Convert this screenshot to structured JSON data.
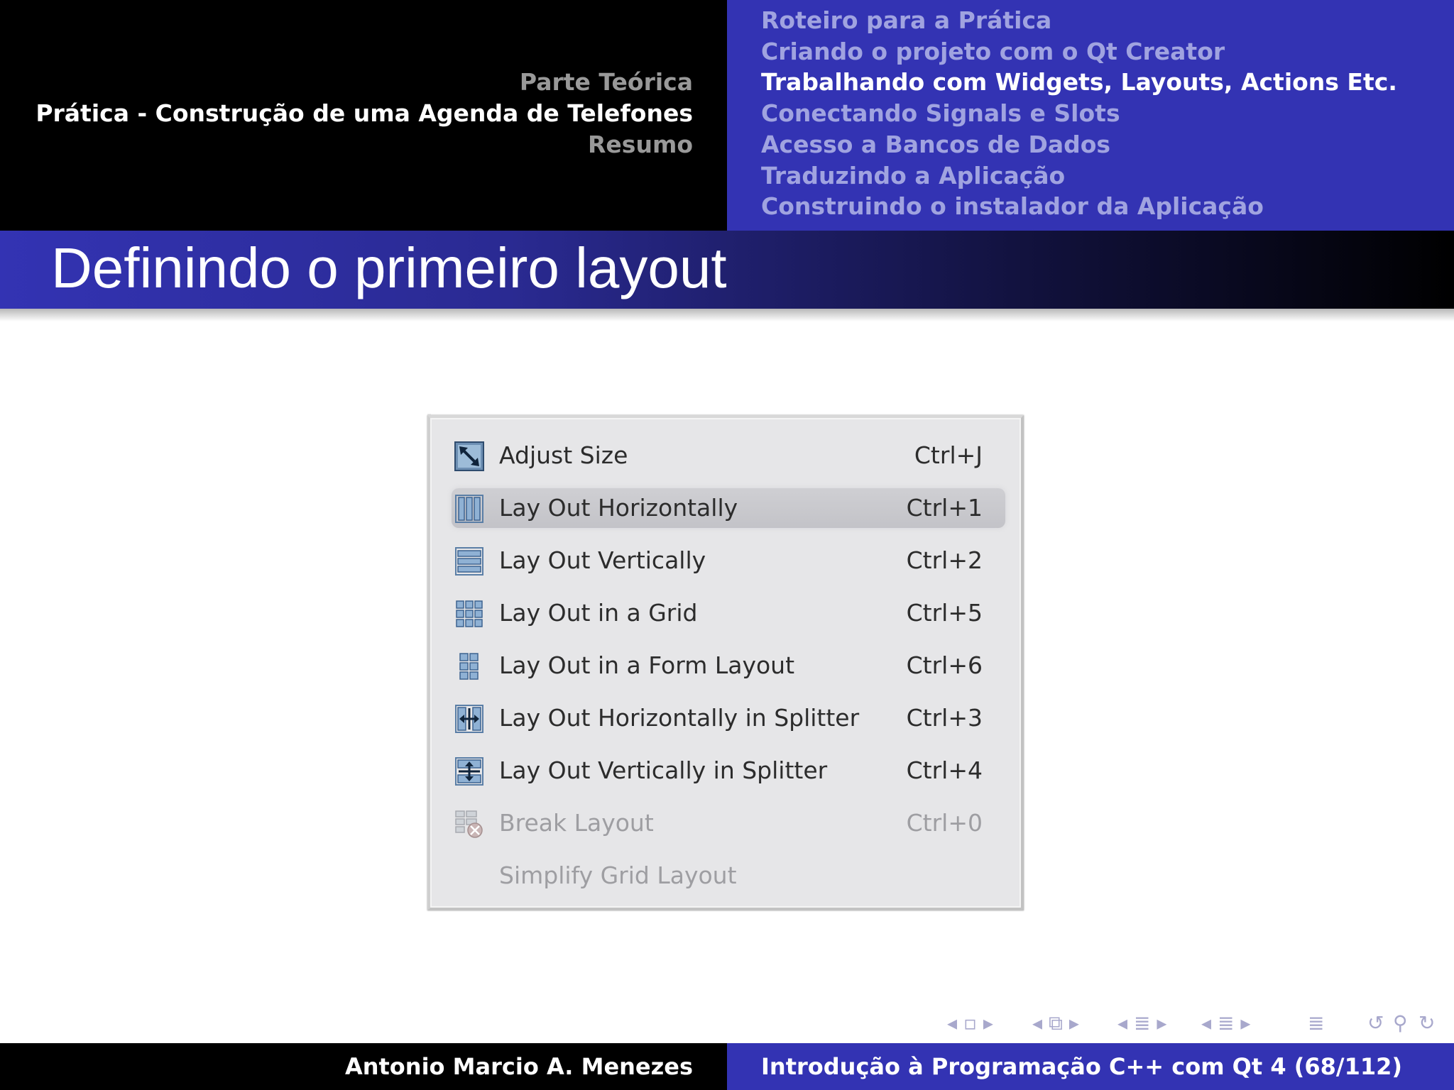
{
  "header": {
    "sections": [
      {
        "label": "Parte Teórica",
        "active": false
      },
      {
        "label": "Prática - Construção de uma Agenda de Telefones",
        "active": true
      },
      {
        "label": "Resumo",
        "active": false
      }
    ],
    "subsections": [
      {
        "label": "Roteiro para a Prática",
        "active": false
      },
      {
        "label": "Criando o projeto com o Qt Creator",
        "active": false
      },
      {
        "label": "Trabalhando com Widgets, Layouts, Actions Etc.",
        "active": true
      },
      {
        "label": "Conectando Signals e Slots",
        "active": false
      },
      {
        "label": "Acesso a Bancos de Dados",
        "active": false
      },
      {
        "label": "Traduzindo a Aplicação",
        "active": false
      },
      {
        "label": "Construindo o instalador da Aplicação",
        "active": false
      }
    ]
  },
  "frame": {
    "title": "Definindo o primeiro layout"
  },
  "menu": {
    "items": [
      {
        "label": "Adjust Size",
        "shortcut": "Ctrl+J",
        "icon": "adjust-size-icon",
        "highlighted": false,
        "disabled": false
      },
      {
        "label": "Lay Out Horizontally",
        "shortcut": "Ctrl+1",
        "icon": "layout-horizontal-icon",
        "highlighted": true,
        "disabled": false
      },
      {
        "label": "Lay Out Vertically",
        "shortcut": "Ctrl+2",
        "icon": "layout-vertical-icon",
        "highlighted": false,
        "disabled": false
      },
      {
        "label": "Lay Out in a Grid",
        "shortcut": "Ctrl+5",
        "icon": "layout-grid-icon",
        "highlighted": false,
        "disabled": false
      },
      {
        "label": "Lay Out in a Form Layout",
        "shortcut": "Ctrl+6",
        "icon": "layout-form-icon",
        "highlighted": false,
        "disabled": false
      },
      {
        "label": "Lay Out Horizontally in Splitter",
        "shortcut": "Ctrl+3",
        "icon": "splitter-horizontal-icon",
        "highlighted": false,
        "disabled": false
      },
      {
        "label": "Lay Out Vertically in Splitter",
        "shortcut": "Ctrl+4",
        "icon": "splitter-vertical-icon",
        "highlighted": false,
        "disabled": false
      },
      {
        "label": "Break Layout",
        "shortcut": "Ctrl+0",
        "icon": "break-layout-icon",
        "highlighted": false,
        "disabled": true
      },
      {
        "label": "Simplify Grid Layout",
        "shortcut": "",
        "icon": "",
        "highlighted": false,
        "disabled": true
      }
    ]
  },
  "nav": {
    "icons": [
      "nav-frame-icon",
      "nav-subsection-icon",
      "nav-section-icon",
      "nav-document-icon",
      "nav-back-icon",
      "nav-search-icon",
      "nav-forward-icon"
    ]
  },
  "footer": {
    "author": "Antonio Marcio A. Menezes",
    "title": "Introdução à Programação C++ com Qt 4 (68/112)"
  },
  "colors": {
    "beamer_blue": "#3333b3",
    "inactive_section": "#999999",
    "inactive_subsection": "#a0a3e0"
  }
}
